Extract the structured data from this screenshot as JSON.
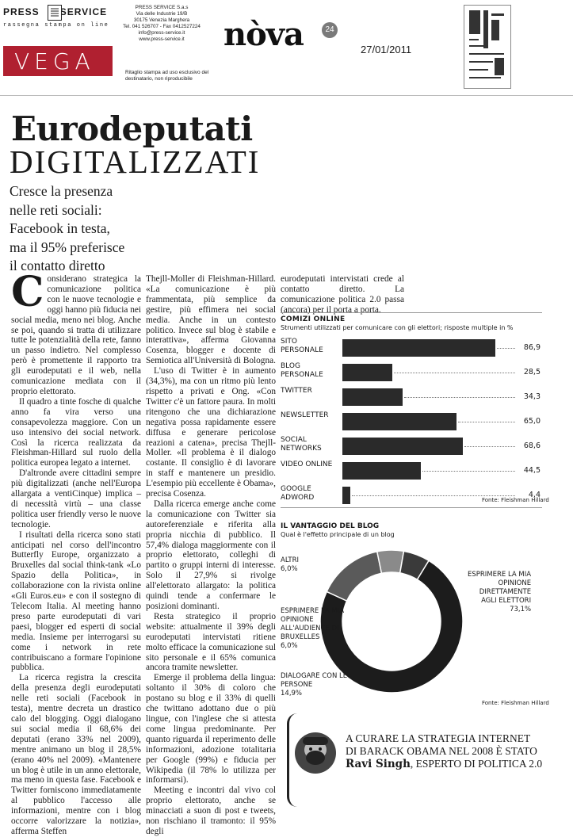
{
  "header": {
    "press_service": "PRESS",
    "press_service_b": "SERVICE",
    "press_sub": "rassegna stampa on line",
    "address": [
      "PRESS SERVICE S.a.s",
      "Via delle Industrie 19/B",
      "30175 Venezia Marghera",
      "Tel. 041 526707 - Fax 0412527224",
      "info@press-service.it",
      "www.press-service.it"
    ],
    "vega_logo": "VEGA",
    "disclaimer": "Ritaglio stampa ad uso esclusivo del destinatario, non riproducibile",
    "publication": "nòva",
    "publication_badge": "24",
    "date": "27/01/2011"
  },
  "article": {
    "title": "Eurodeputati",
    "subtitle": "DIGITALIZZATI",
    "deck": [
      "Cresce la presenza",
      "nelle reti sociali:",
      "Facebook in testa,",
      "ma il 95% preferisce",
      "il contatto diretto"
    ],
    "dropcap": "C",
    "col1": [
      "onsiderano strategica la comunicazione politica con le nuove tecnologie e oggi hanno più fiducia nei social media, meno nei blog. Anche se poi, quando si tratta di utilizzare tutte le potenzialità della rete, fanno un passo indietro. Nel complesso però è promettente il rapporto tra gli eurodeputati e il web, nella comunicazione mediata con il proprio elettorato.",
      "Il quadro a tinte fosche di qualche anno fa vira verso una consapevolezza maggiore. Con un uso intensivo dei social network. Così la ricerca realizzata da Fleishman-Hillard sul ruolo della politica europea legato a internet.",
      "D'altronde avere cittadini sempre più digitalizzati (anche nell'Europa allargata a ventiCinque) implica – di necessità virtù – una classe politica user friendly verso le nuove tecnologie.",
      "I risultati della ricerca sono stati anticipati nel corso dell'incontro Butterfly Europe, organizzato a Bruxelles dal social think-tank «Lo Spazio della Politica», in collaborazione con la rivista online «Gli Euros.eu» e con il sostegno di Telecom Italia. Al meeting hanno preso parte eurodeputati di vari paesi, blogger ed esperti di social media. Insieme per interrogarsi su come i network in rete contribuiscano a formare l'opinione pubblica.",
      "La ricerca registra la crescita della presenza degli eurodeputati nelle reti sociali (Facebook in testa), mentre decreta un drastico calo del blogging. Oggi dialogano sui social media il 68,6% dei deputati (erano 33% nel 2009), mentre animano un blog il 28,5% (erano 40% nel 2009). «Mantenere un blog è utile in un anno elettorale, ma meno in questa fase. Facebook e Twitter forniscono immediatamente al pubblico l'accesso alle informazioni, mentre con i blog occorre valorizzare la notizia», afferma Steffen"
    ],
    "col2": [
      "Thejll-Moller di Fleishman-Hillard. «La comunicazione è più frammentata, più semplice da gestire, più effimera nei social media. Anche in un contesto politico. Invece sul blog è stabile e interattiva», afferma Giovanna Cosenza, blogger e docente di Semiotica all'Università di Bologna.",
      "L'uso di Twitter è in aumento (34,3%), ma con un ritmo più lento rispetto a privati e Ong. «Con Twitter c'è un fattore paura. In molti ritengono che una dichiarazione negativa possa rapidamente essere diffusa e generare pericolose reazioni a catena», precisa Thejll-Moller. «Il problema è il dialogo costante. Il consiglio è di lavorare in staff e mantenere un presidio. L'esempio più eccellente è Obama», precisa Cosenza.",
      "Dalla ricerca emerge anche come la comunicazione con Twitter sia autoreferenziale e riferita alla propria nicchia di pubblico. Il 57,4% dialoga maggiormente con il proprio elettorato, colleghi di partito o gruppi interni di interesse. Solo il 27,9% si rivolge all'elettorato allargato: la politica quindi tende a confermare le posizioni dominanti.",
      "Resta strategico il proprio website: attualmente il 39% degli eurodeputati intervistati ritiene molto efficace la comunicazione sul sito personale e il 65% comunica ancora tramite newsletter.",
      "Emerge il problema della lingua: soltanto il 30% di coloro che postano su blog e il 33% di quelli che twittano adottano due o più lingue, con l'inglese che si attesta come lingua predominante. Per quanto riguarda il reperimento delle informazioni, adozione totalitaria per Google (99%) e fiducia per Wikipedia (il 78% lo utilizza per informarsi).",
      "Meeting e incontri dal vivo col proprio elettorato, anche se minacciati a suon di post e tweets, non rischiano il tramonto: il 95% degli"
    ],
    "col3": [
      "eurodeputati intervistati crede al contatto diretto. La comunicazione politica 2.0 passa (ancora) per il porta a porta."
    ]
  },
  "chart_data": [
    {
      "type": "bar",
      "title": "COMIZI ONLINE",
      "subtitle": "Strumenti utilizzati per comunicare con gli elettori; risposte multiple in %",
      "categories": [
        "SITO PERSONALE",
        "BLOG PERSONALE",
        "TWITTER",
        "NEWSLETTER",
        "SOCIAL NETWORKS",
        "VIDEO ONLINE",
        "GOOGLE ADWORD"
      ],
      "values": [
        86.9,
        28.5,
        34.3,
        65.0,
        68.6,
        44.5,
        4.4
      ],
      "value_labels": [
        "86,9",
        "28,5",
        "34,3",
        "65,0",
        "68,6",
        "44,5",
        "4,4"
      ],
      "source": "Fonte: Fleishman Hillard",
      "xlim": [
        0,
        100
      ]
    },
    {
      "type": "pie",
      "title": "IL VANTAGGIO DEL BLOG",
      "subtitle": "Qual è l'effetto principale di un blog",
      "categories": [
        "ESPRIMERE LA MIA OPINIONE DIRETTAMENTE AGLI ELETTORI",
        "DIALOGARE CON LE PERSONE",
        "ESPRIMERE LA MIA OPINIONE ALL'AUDIENCE DI BRUXELLES",
        "ALTRI"
      ],
      "values": [
        73.1,
        14.9,
        6.0,
        6.0
      ],
      "value_labels": [
        "73,1%",
        "14,9%",
        "6,0%",
        "6,0%"
      ],
      "source": "Fonte: Fleishman Hillard"
    }
  ],
  "quote": {
    "lines": [
      "A CURARE LA STRATEGIA INTERNET",
      "DI BARACK OBAMA NEL 2008 È STATO"
    ],
    "name": "Ravi Singh",
    "role": ", ESPERTO DI POLITICA 2.0"
  }
}
